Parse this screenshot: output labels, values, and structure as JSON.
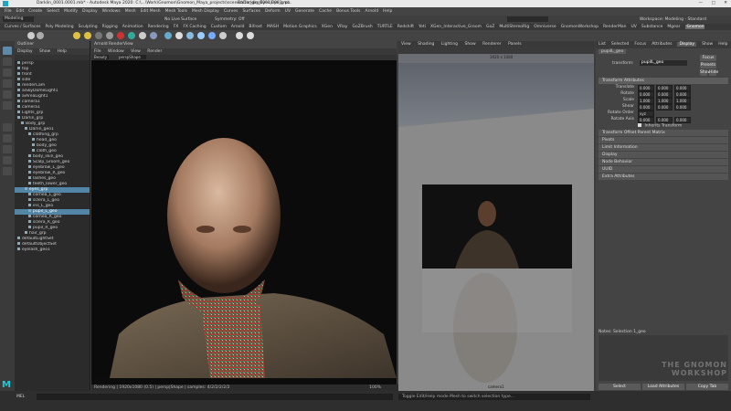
{
  "window": {
    "title": "Darklin_0001.0001.mb* - Autodesk Maya 2020: C:\\...\\Work\\Gnomon\\Gnomon_Maya_projects\\scenes\\Darklin_0001.0001.mb",
    "title_right": "Darlin_grp|Eyes|Eye_grp...",
    "buttons": [
      "—",
      "□",
      "✕"
    ]
  },
  "menubar": [
    "File",
    "Edit",
    "Create",
    "Select",
    "Modify",
    "Display",
    "Windows",
    "Mesh",
    "Edit Mesh",
    "Mesh Tools",
    "Mesh Display",
    "Curves",
    "Surfaces",
    "Deform",
    "UV",
    "Generate",
    "Cache",
    "Bonus Tools",
    "Arnold",
    "Help"
  ],
  "status": {
    "mode": "Modeling",
    "live": "No Live Surface",
    "symmetry": "Symmetry: Off",
    "workspace": "Workspace: Modeling - Standard"
  },
  "shelf_tabs": [
    "Curves / Surfaces",
    "Poly Modeling",
    "Sculpting",
    "Rigging",
    "Animation",
    "Rendering",
    "FX",
    "FX Caching",
    "Custom",
    "Arnold",
    "Bifrost",
    "MASH",
    "Motion Graphics",
    "XGen",
    "VRay",
    "GoZBrush",
    "TURTLE",
    "Redshift",
    "Yeti",
    "XGen_Interactive_Groom",
    "GoZ",
    "MultiStereoRig",
    "Omniverse",
    "GnomonWorkshop",
    "RenderMan",
    "UV",
    "Substance",
    "Mgear",
    "Gnomon 24.0",
    "Polyhaven",
    "Hair",
    "Look Development"
  ],
  "shelf_active": "Gnomon 24.0",
  "outliner": {
    "title": "Outliner",
    "menu": [
      "Display",
      "Show",
      "Help"
    ],
    "items": [
      {
        "label": "persp",
        "sel": false
      },
      {
        "label": "top",
        "sel": false
      },
      {
        "label": "front",
        "sel": false
      },
      {
        "label": "side",
        "sel": false
      },
      {
        "label": "renderCam",
        "sel": false
      },
      {
        "label": "aiSkyDomeLight1",
        "sel": false
      },
      {
        "label": "aiAreaLight1",
        "sel": false
      },
      {
        "label": "camera1",
        "sel": false
      },
      {
        "label": "camera1",
        "sel": false
      },
      {
        "label": "Lights_grp",
        "sel": false
      },
      {
        "label": "Darlin_grp",
        "sel": false
      },
      {
        "label": "Body_grp",
        "sel": false
      },
      {
        "label": "Darlin_geo1",
        "sel": false
      },
      {
        "label": "clothing_grp",
        "sel": false
      },
      {
        "label": "head_geo",
        "sel": false
      },
      {
        "label": "body_geo",
        "sel": false
      },
      {
        "label": "cloth_geo",
        "sel": false
      },
      {
        "label": "body_skin_geo",
        "sel": false
      },
      {
        "label": "Scalp_Groom_geo",
        "sel": false
      },
      {
        "label": "eyebrow_L_geo",
        "sel": false
      },
      {
        "label": "eyebrow_R_geo",
        "sel": false
      },
      {
        "label": "lashes_geo",
        "sel": false
      },
      {
        "label": "teeth_lower_geo",
        "sel": false
      },
      {
        "label": "eyes_grp",
        "sel": true
      },
      {
        "label": "cornea_L_geo",
        "sel": false
      },
      {
        "label": "sclera_L_geo",
        "sel": false
      },
      {
        "label": "iris_L_geo",
        "sel": false
      },
      {
        "label": "pupil_L_geo",
        "sel": true
      },
      {
        "label": "cornea_R_geo",
        "sel": false
      },
      {
        "label": "sclera_R_geo",
        "sel": false
      },
      {
        "label": "pupil_R_geo",
        "sel": false
      },
      {
        "label": "hair_grp",
        "sel": false
      },
      {
        "label": "defaultLightSet",
        "sel": false
      },
      {
        "label": "defaultObjectSet",
        "sel": false
      },
      {
        "label": "eyelash_geo1",
        "sel": false
      }
    ]
  },
  "renderview": {
    "title": "Arnold RenderView",
    "menu": [
      "File",
      "Window",
      "View",
      "Render"
    ],
    "dropdown_left": "Beauty",
    "dropdown_right": "perspShape",
    "status": "Rendering | 1920x1080 (0.5) | persp|Shape | samples: 4/2/2/2/2/2",
    "zoom": "100%"
  },
  "viewport": {
    "menu": [
      "View",
      "Shading",
      "Lighting",
      "Show",
      "Renderer",
      "Panels"
    ],
    "resolution": "1920 x 1080",
    "camera": "camera1"
  },
  "attribute_editor": {
    "tabs": [
      "List",
      "Selected",
      "Focus",
      "Attributes",
      "Display",
      "Show",
      "Help"
    ],
    "active_tab": "Display",
    "node_tab": "pupilL_geo",
    "transform_label": "transform:",
    "transform_value": "pupilL_geo",
    "buttons": [
      "Focus",
      "Presets",
      "Show",
      "Hide"
    ],
    "transform_section": "Transform Attributes",
    "fields": [
      {
        "label": "Translate",
        "values": [
          "0.000",
          "0.000",
          "0.000"
        ]
      },
      {
        "label": "Rotate",
        "values": [
          "0.000",
          "0.000",
          "0.000"
        ]
      },
      {
        "label": "Scale",
        "values": [
          "1.000",
          "1.000",
          "1.000"
        ]
      },
      {
        "label": "Shear",
        "values": [
          "0.000",
          "0.000",
          "0.000"
        ]
      },
      {
        "label": "Rotate Order",
        "values": [
          "xyz"
        ]
      },
      {
        "label": "Rotate Axis",
        "values": [
          "0.000",
          "0.000",
          "0.000"
        ]
      }
    ],
    "inherits": "Inherits Transform",
    "sections": [
      "Transform Offset Parent Matrix",
      "Pivots",
      "Limit Information",
      "Display",
      "Node Behavior",
      "UUID",
      "Extra Attributes"
    ],
    "notes_label": "Notes: Selection 1_geo",
    "bottom_buttons": [
      "Select",
      "Load Attributes",
      "Copy Tab"
    ]
  },
  "cmdline": {
    "lang": "MEL",
    "help": "Toggle Edit/Help mode Mesh to switch selection type..."
  },
  "watermark": "THE GNOMON WORKSHOP"
}
